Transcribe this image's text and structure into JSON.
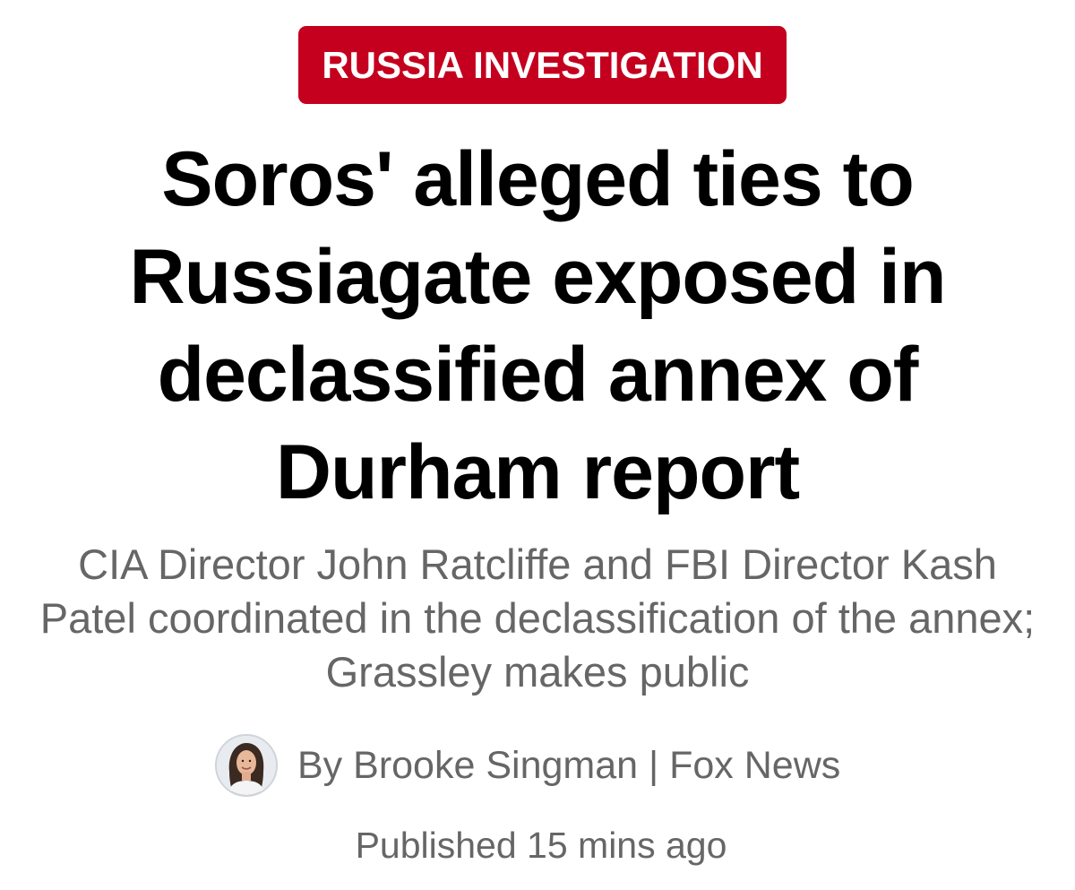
{
  "category": {
    "label": "RUSSIA INVESTIGATION",
    "color": "#c4001e"
  },
  "headline": "Soros' alleged ties to Russiagate exposed in declassified annex of Durham report",
  "subheadline": "CIA Director John Ratcliffe and FBI Director Kash Patel coordinated in the declassification of the annex; Grassley makes public",
  "byline": {
    "prefix": "By",
    "author": "Brooke Singman",
    "separator": "|",
    "outlet": "Fox News",
    "avatar_icon": "author-photo"
  },
  "published": "Published 15 mins ago",
  "colors": {
    "headline": "#000000",
    "secondary_text": "#666666",
    "background": "#ffffff"
  }
}
